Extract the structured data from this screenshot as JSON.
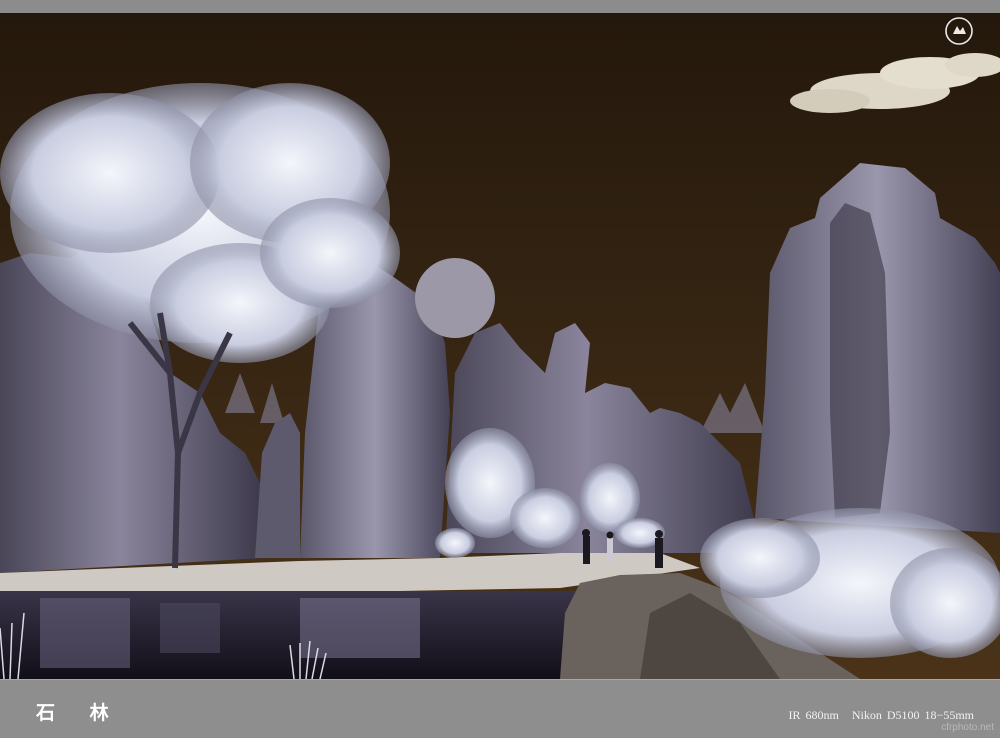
{
  "image": {
    "subject": "Infrared landscape photograph of a karst stone forest with tall limestone pillars, white foliage, a reflecting pond and a dark brown sky",
    "colors": {
      "sky": "#2a1c0f",
      "frame": "#8c8c8c",
      "foliage": "#dfe3ee",
      "rock": "#6e6a80",
      "water": "#1a1420"
    }
  },
  "caption": {
    "title": "石 林",
    "camera_info": [
      "IR 680nm",
      "Nikon D5100 18−55mm"
    ]
  },
  "watermark": {
    "site": "cfrphoto.net",
    "logo_icon": "circular-logo-icon"
  }
}
